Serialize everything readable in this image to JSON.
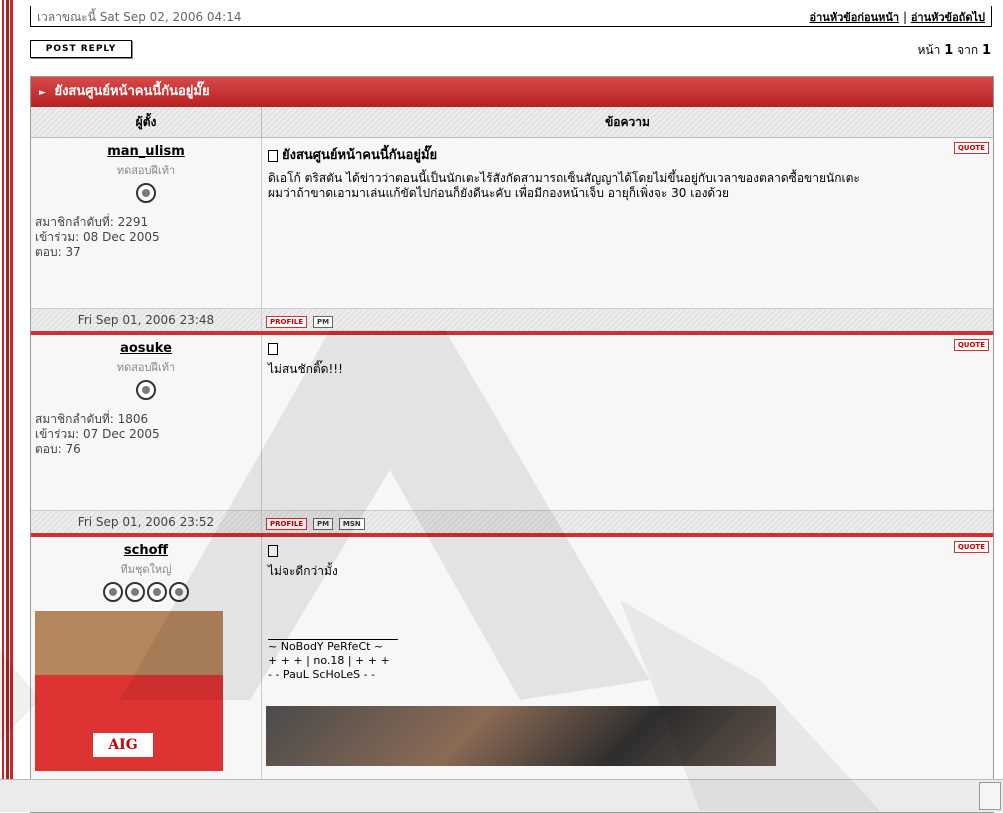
{
  "topbar": {
    "date_text": "เวลาขณะนี้ Sat Sep 02, 2006 04:14",
    "prev_topic": "อ่านหัวข้อก่อนหน้า",
    "next_topic": "อ่านหัวข้อถัดไป",
    "nav_sep": "|"
  },
  "toolbar": {
    "post_reply_label": "POST REPLY"
  },
  "pagination": {
    "prefix": "หน้า",
    "current": "1",
    "of": "จาก",
    "total": "1"
  },
  "topic": {
    "title": "ยังสนศูนย์หน้าคนนี้กันอยู่มั๊ย"
  },
  "table_headers": {
    "author": "ผู้ตั้ง",
    "message": "ข้อความ"
  },
  "posts": [
    {
      "username": "man_ulism",
      "rank": "ทดสอบฝีเท้า",
      "stats": [
        "สมาชิกลำดับที่: 2291",
        "เข้าร่วม: 08 Dec 2005",
        "ตอบ: 37"
      ],
      "subject": "ยังสนศูนย์หน้าคนนี้กันอยู่มั๊ย",
      "body": [
        "ดิเอโก้ ตริสตัน ได้ข่าวว่าตอนนี้เป็นนักเตะไร้สังกัดสามารถเซ็นสัญญาได้โดยไม่ขึ้นอยู่กับเวลาของตลาดซื้อขายนักเตะ",
        "ผมว่าถ้าขาดเอามาเล่นแก้ขัดไปก่อนก็ยังดีนะคับ เพื่อมีกองหน้าเจ็บ อายุก็เพิ่งจะ 30 เองด้วย"
      ],
      "date": "Fri Sep 01, 2006 23:48",
      "buttons": [
        "PROFILE",
        "PM"
      ]
    },
    {
      "username": "aosuke",
      "rank": "ทดสอบฝีเท้า",
      "stats": [
        "สมาชิกลำดับที่: 1806",
        "เข้าร่วม: 07 Dec 2005",
        "ตอบ: 76"
      ],
      "subject": "",
      "body": [
        "ไม่สนชักติ๊ด!!!"
      ],
      "date": "Fri Sep 01, 2006 23:52",
      "buttons": [
        "PROFILE",
        "PM",
        "MSN"
      ]
    },
    {
      "username": "schoff",
      "rank": "ทีมชุดใหญ่",
      "avatar_text": "AIG",
      "subject": "",
      "body": [
        "ไม่จะดีกว่ามั้ง"
      ],
      "signature": [
        "~ NoBodY PeRfeCt ~",
        "+ + + | no.18 | + + +",
        "- - PauL ScHoLeS - -"
      ]
    }
  ],
  "quote_label": "QUOTE"
}
